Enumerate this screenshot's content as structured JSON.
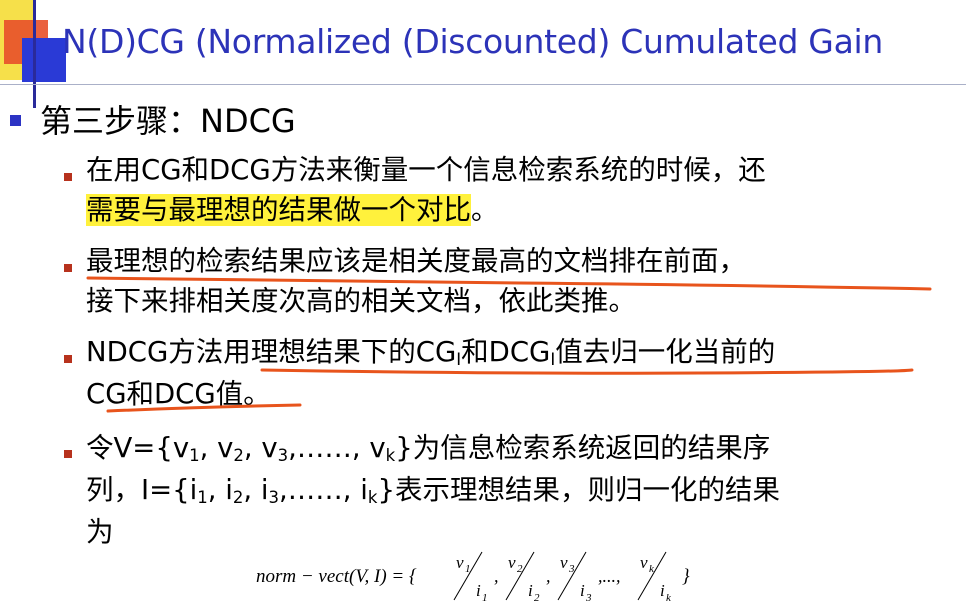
{
  "slide": {
    "title": "N(D)CG (Normalized (Discounted) Cumulated Gain",
    "step": "第三步骤：NDCG",
    "bullets": [
      {
        "line1": "在用CG和DCG方法来衡量一个信息检索系统的时候，还",
        "line2_highlight": "需要与最理想的结果做一个对比",
        "line2_end": "。"
      },
      {
        "line1": "最理想的检索结果应该是相关度最高的文档排在前面，",
        "line2": "接下来排相关度次高的相关文档，依此类推。"
      },
      {
        "line1_a": "NDCG方法用理想结果下的CG",
        "sub_i": "I",
        "line1_b": "和DCG",
        "line1_c": "值去归一化当前的",
        "line2": "CG和DCG值。"
      },
      {
        "p1": "令V={v",
        "s1": "1",
        "p2": ", v",
        "s2": "2",
        "p3": ", v",
        "s3": "3",
        "p4": ",……, v",
        "sk": "k",
        "p5": "}为信息检索系统返回的结果序",
        "q1": "列，I={i",
        "t1": "1",
        "q2": ", i",
        "t2": "2",
        "q3": ", i",
        "t3": "3",
        "q4": ",……, i",
        "tk": "k",
        "q5": "}表示理想结果，则归一化的结果",
        "line3": "为"
      }
    ],
    "formula": {
      "lhs": "norm − vect(V, I) = {",
      "num1": "v",
      "num1_sub": "1",
      "den1": "i",
      "den1_sub": "1",
      "num2": "v",
      "num2_sub": "2",
      "den2": "i",
      "den2_sub": "2",
      "num3": "v",
      "num3_sub": "3",
      "den3": "i",
      "den3_sub": "3",
      "ellipsis": ",...,",
      "numk": "v",
      "numk_sub": "k",
      "denk": "i",
      "denk_sub": "k",
      "close": "}"
    }
  },
  "colors": {
    "title": "#2c33b8",
    "bullet_level1": "#2c33c4",
    "bullet_level2": "#b7321d",
    "highlight": "#fff13c",
    "underline_pen": "#e8541c"
  }
}
